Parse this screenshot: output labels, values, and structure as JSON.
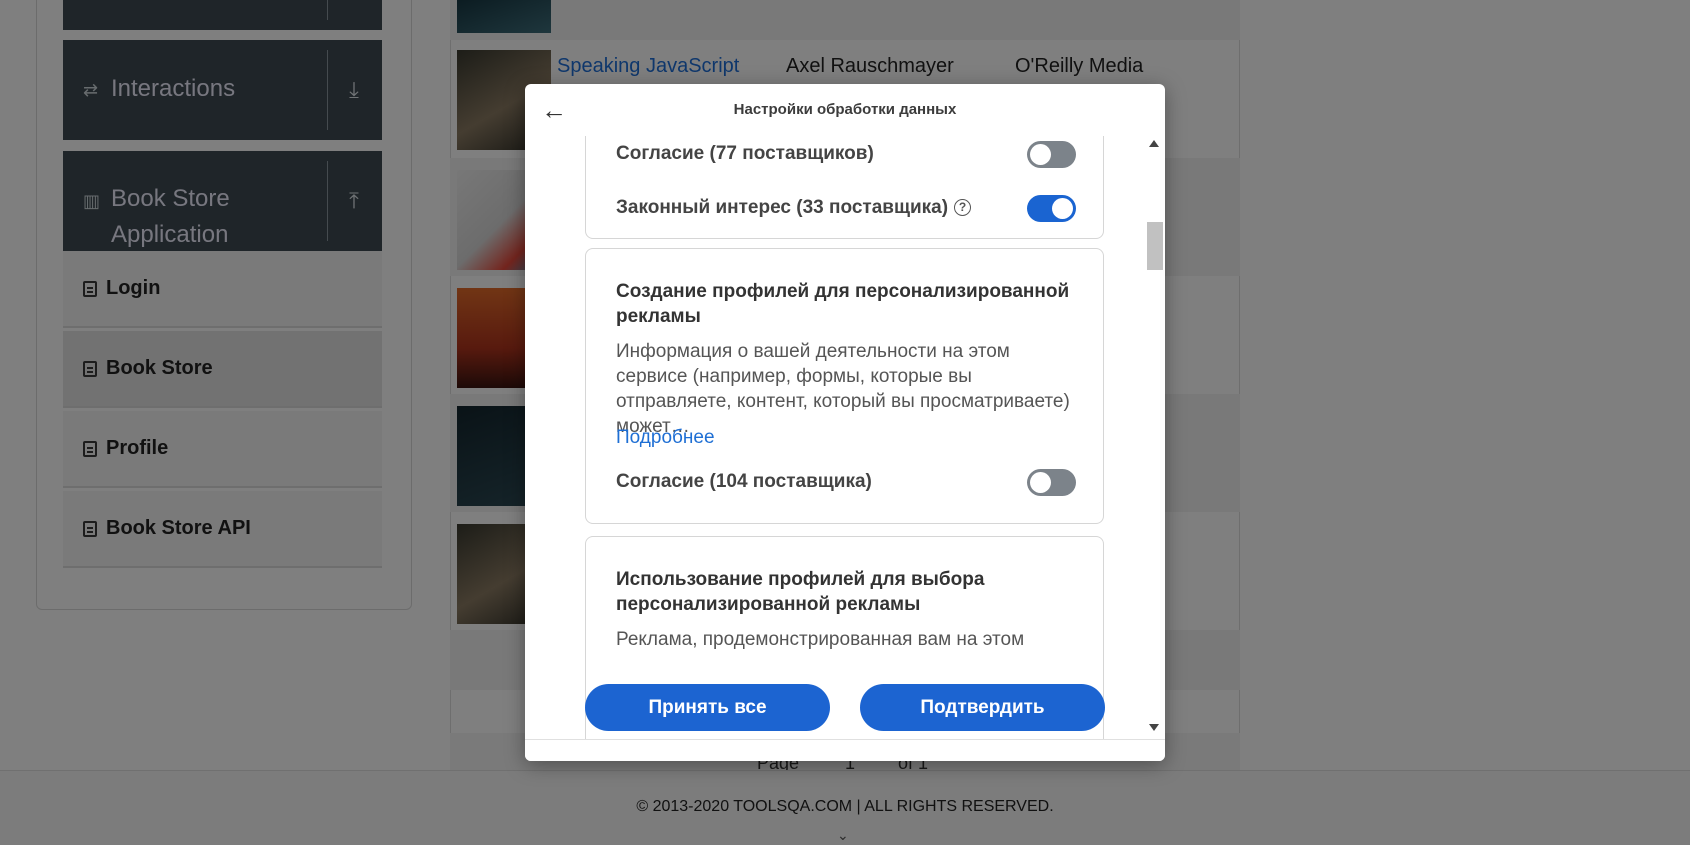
{
  "sidebar": {
    "groups": [
      {
        "label": "Interactions",
        "icon": "interactions-icon",
        "toggle_icon": "download-icon"
      },
      {
        "label": "Book Store Application",
        "icon": "books-icon",
        "toggle_icon": "upload-icon"
      }
    ],
    "items": [
      {
        "label": "Login"
      },
      {
        "label": "Book Store"
      },
      {
        "label": "Profile"
      },
      {
        "label": "Book Store API"
      }
    ]
  },
  "table": {
    "rows": [
      {
        "title": "Speaking JavaScript",
        "author": "Axel Rauschmayer",
        "publisher": "O'Reilly Media"
      }
    ],
    "pager": {
      "page_label": "Page",
      "page_value": "1",
      "of_label": "of 1"
    }
  },
  "footer": {
    "copyright": "© 2013-2020 TOOLSQA.COM | ALL RIGHTS RESERVED."
  },
  "modal": {
    "title": "Настройки обработки данных",
    "back_icon": "arrow-left-icon",
    "top_card": {
      "consent_label": "Согласие (77 поставщиков)",
      "consent_on": false,
      "legit_label": "Законный интерес (33 поставщика)",
      "legit_on": true,
      "help_icon": "question-circle-icon"
    },
    "card_profiles": {
      "title": "Создание профилей для персонализированной рекламы",
      "description": "Информация о вашей деятельности на этом сервисе (например, формы, которые вы отправляете, контент, который вы просматриваете) может…",
      "more_link": "Подробнее",
      "consent_label": "Согласие (104 поставщика)",
      "consent_on": false
    },
    "card_use_profiles": {
      "title": "Использование профилей для выбора персонализированной рекламы",
      "description": "Реклама, продемонстрированная вам на этом"
    },
    "buttons": {
      "accept_all": "Принять все",
      "confirm": "Подтвердить"
    },
    "colors": {
      "accent": "#1c64d1",
      "toggle_off": "#7c838a"
    }
  }
}
